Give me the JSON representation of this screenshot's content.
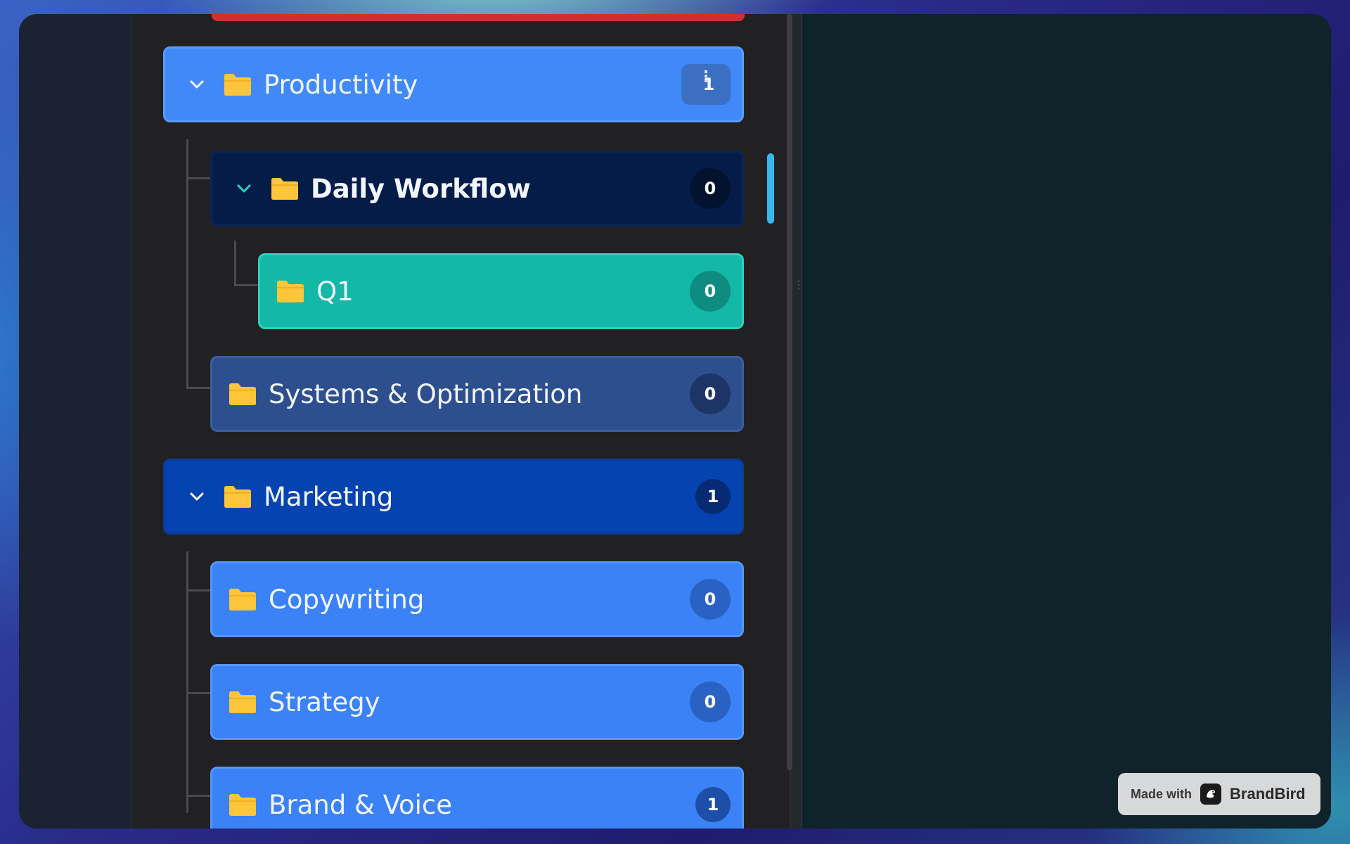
{
  "tree": {
    "items": [
      {
        "label": "Productivity",
        "count": "1",
        "expanded": true
      },
      {
        "label": "Daily Workflow",
        "count": "0",
        "expanded": true
      },
      {
        "label": "Q1",
        "count": "0"
      },
      {
        "label": "Systems & Optimization",
        "count": "0"
      },
      {
        "label": "Marketing",
        "count": "1",
        "expanded": true
      },
      {
        "label": "Copywriting",
        "count": "0"
      },
      {
        "label": "Strategy",
        "count": "0"
      },
      {
        "label": "Brand & Voice",
        "count": "1"
      }
    ]
  },
  "watermark": {
    "made_with": "Made with",
    "brand": "BrandBird"
  },
  "colors": {
    "productivity": "#4189f8",
    "daily_workflow": "#061c48",
    "q1": "#13b8a6",
    "systems": "#2e4f8e",
    "marketing": "#0544b0",
    "child_blue": "#3b82f6",
    "folder": "#fcc53a"
  }
}
